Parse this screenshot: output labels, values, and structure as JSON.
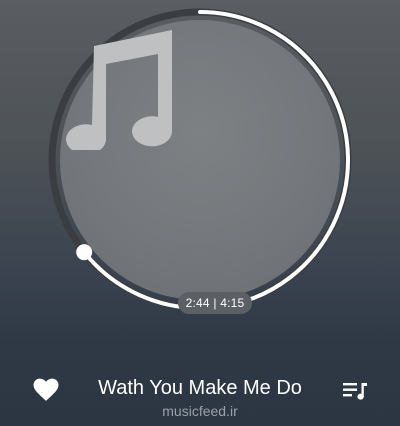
{
  "player": {
    "elapsed": "2:44",
    "separator": "|",
    "duration": "4:15",
    "progress_fraction": 0.643,
    "artwork_icon": "music-note-icon"
  },
  "track": {
    "title": "Wath You Make Me Do",
    "artist": "musicfeed.ir"
  },
  "controls": {
    "favorite_icon": "heart-icon",
    "queue_icon": "playlist-icon"
  },
  "colors": {
    "progress": "#ffffff",
    "track_ring": "#3a3e43",
    "artwork_bg": "#74777b"
  }
}
